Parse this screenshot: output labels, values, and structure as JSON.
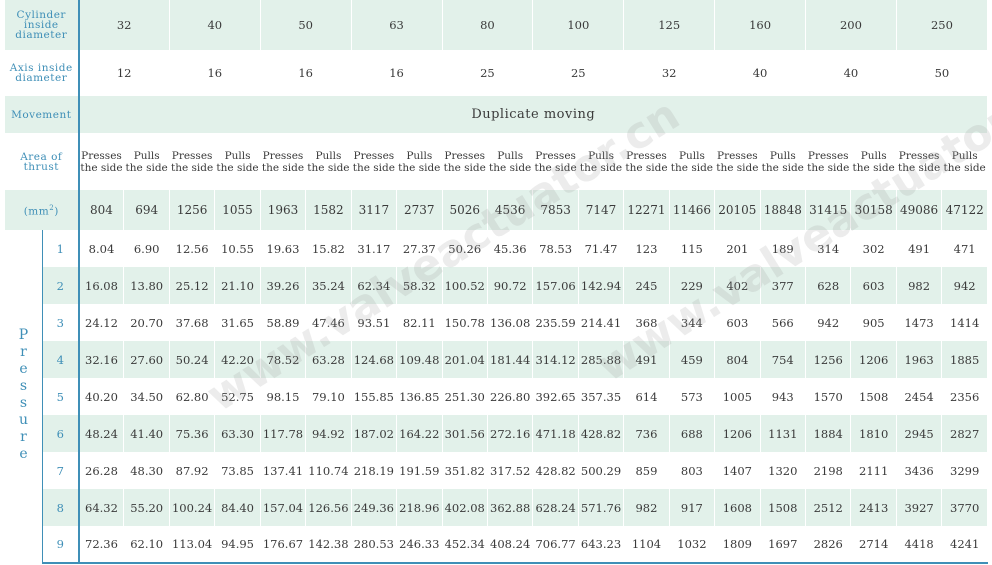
{
  "labels": {
    "cylinder": "Cylinder inside diameter",
    "axis": "Axis inside diameter",
    "movement": "Movement",
    "area": "Area of thrust",
    "unit_pre": "(mm",
    "unit_sup": "2",
    "unit_post": ")",
    "pressure": "Pressure"
  },
  "movement_value": "Duplicate moving",
  "cylinder_diameters": [
    "32",
    "40",
    "50",
    "63",
    "80",
    "100",
    "125",
    "160",
    "200",
    "250"
  ],
  "axis_diameters": [
    "12",
    "16",
    "16",
    "16",
    "25",
    "25",
    "32",
    "40",
    "40",
    "50"
  ],
  "thrust_labels": {
    "presses": "Presses the side",
    "pulls": "Pulls the side"
  },
  "area_values": [
    "804",
    "694",
    "1256",
    "1055",
    "1963",
    "1582",
    "3117",
    "2737",
    "5026",
    "4536",
    "7853",
    "7147",
    "12271",
    "11466",
    "20105",
    "18848",
    "31415",
    "30158",
    "49086",
    "47122"
  ],
  "pressure_rows": [
    {
      "index": "1",
      "values": [
        "8.04",
        "6.90",
        "12.56",
        "10.55",
        "19.63",
        "15.82",
        "31.17",
        "27.37",
        "50.26",
        "45.36",
        "78.53",
        "71.47",
        "123",
        "115",
        "201",
        "189",
        "314",
        "302",
        "491",
        "471"
      ]
    },
    {
      "index": "2",
      "values": [
        "16.08",
        "13.80",
        "25.12",
        "21.10",
        "39.26",
        "35.24",
        "62.34",
        "58.32",
        "100.52",
        "90.72",
        "157.06",
        "142.94",
        "245",
        "229",
        "402",
        "377",
        "628",
        "603",
        "982",
        "942"
      ]
    },
    {
      "index": "3",
      "values": [
        "24.12",
        "20.70",
        "37.68",
        "31.65",
        "58.89",
        "47.46",
        "93.51",
        "82.11",
        "150.78",
        "136.08",
        "235.59",
        "214.41",
        "368",
        "344",
        "603",
        "566",
        "942",
        "905",
        "1473",
        "1414"
      ]
    },
    {
      "index": "4",
      "values": [
        "32.16",
        "27.60",
        "50.24",
        "42.20",
        "78.52",
        "63.28",
        "124.68",
        "109.48",
        "201.04",
        "181.44",
        "314.12",
        "285.88",
        "491",
        "459",
        "804",
        "754",
        "1256",
        "1206",
        "1963",
        "1885"
      ]
    },
    {
      "index": "5",
      "values": [
        "40.20",
        "34.50",
        "62.80",
        "52.75",
        "98.15",
        "79.10",
        "155.85",
        "136.85",
        "251.30",
        "226.80",
        "392.65",
        "357.35",
        "614",
        "573",
        "1005",
        "943",
        "1570",
        "1508",
        "2454",
        "2356"
      ]
    },
    {
      "index": "6",
      "values": [
        "48.24",
        "41.40",
        "75.36",
        "63.30",
        "117.78",
        "94.92",
        "187.02",
        "164.22",
        "301.56",
        "272.16",
        "471.18",
        "428.82",
        "736",
        "688",
        "1206",
        "1131",
        "1884",
        "1810",
        "2945",
        "2827"
      ]
    },
    {
      "index": "7",
      "values": [
        "26.28",
        "48.30",
        "87.92",
        "73.85",
        "137.41",
        "110.74",
        "218.19",
        "191.59",
        "351.82",
        "317.52",
        "428.82",
        "500.29",
        "859",
        "803",
        "1407",
        "1320",
        "2198",
        "2111",
        "3436",
        "3299"
      ]
    },
    {
      "index": "8",
      "values": [
        "64.32",
        "55.20",
        "100.24",
        "84.40",
        "157.04",
        "126.56",
        "249.36",
        "218.96",
        "402.08",
        "362.88",
        "628.24",
        "571.76",
        "982",
        "917",
        "1608",
        "1508",
        "2512",
        "2413",
        "3927",
        "3770"
      ]
    },
    {
      "index": "9",
      "values": [
        "72.36",
        "62.10",
        "113.04",
        "94.95",
        "176.67",
        "142.38",
        "280.53",
        "246.33",
        "452.34",
        "408.24",
        "706.77",
        "643.23",
        "1104",
        "1032",
        "1809",
        "1697",
        "2826",
        "2714",
        "4418",
        "4241"
      ]
    }
  ],
  "watermark": "www.valveactuator.cn",
  "colors": {
    "label": "#3f8fb7",
    "shade": "#e2f1ea",
    "text": "#3a3a3a"
  }
}
